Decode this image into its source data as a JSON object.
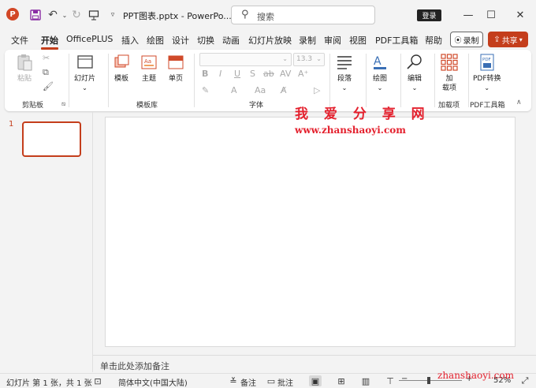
{
  "app": {
    "logo_letter": "P",
    "doc_title": "PPT图表.pptx - PowerPo..."
  },
  "search": {
    "placeholder": "搜索"
  },
  "titlebar": {
    "login": "登录",
    "minimize": "—",
    "maximize": "☐",
    "close": "✕"
  },
  "menu": {
    "tabs": [
      "文件",
      "开始",
      "OfficePLUS",
      "插入",
      "绘图",
      "设计",
      "切换",
      "动画",
      "幻灯片放映",
      "录制",
      "审阅",
      "视图",
      "PDF工具箱",
      "帮助"
    ],
    "active": "开始",
    "record_label": "录制",
    "share_label": "共享"
  },
  "ribbon": {
    "clipboard": {
      "paste": "粘贴",
      "group": "剪贴板"
    },
    "slides_btn": "幻灯片",
    "template": {
      "items": [
        "模板",
        "主题",
        "单页"
      ],
      "group": "模板库"
    },
    "font": {
      "size": "13.3",
      "group": "字体",
      "aa_label": "Aa"
    },
    "paragraph": "段落",
    "drawing": "绘图",
    "editing": "编辑",
    "addins": {
      "btn_line1": "加",
      "btn_line2": "载项",
      "group": "加载项"
    },
    "pdf": {
      "btn": "PDF转换",
      "group": "PDF工具箱",
      "icon_text": "PDF"
    }
  },
  "slides_panel": {
    "number": "1"
  },
  "notes": {
    "placeholder": "单击此处添加备注"
  },
  "watermark": {
    "title": "我 爱 分 享 网",
    "url": "www.zhanshaoyi.com",
    "corner": "zhanshaoyi.com"
  },
  "status": {
    "slide_info": "幻灯片 第 1 张，共 1 张",
    "language": "简体中文(中国大陆)",
    "notes": "备注",
    "comments": "批注",
    "zoom": "52%"
  },
  "colors": {
    "accent": "#c43e1c",
    "watermark": "#e4212e"
  }
}
